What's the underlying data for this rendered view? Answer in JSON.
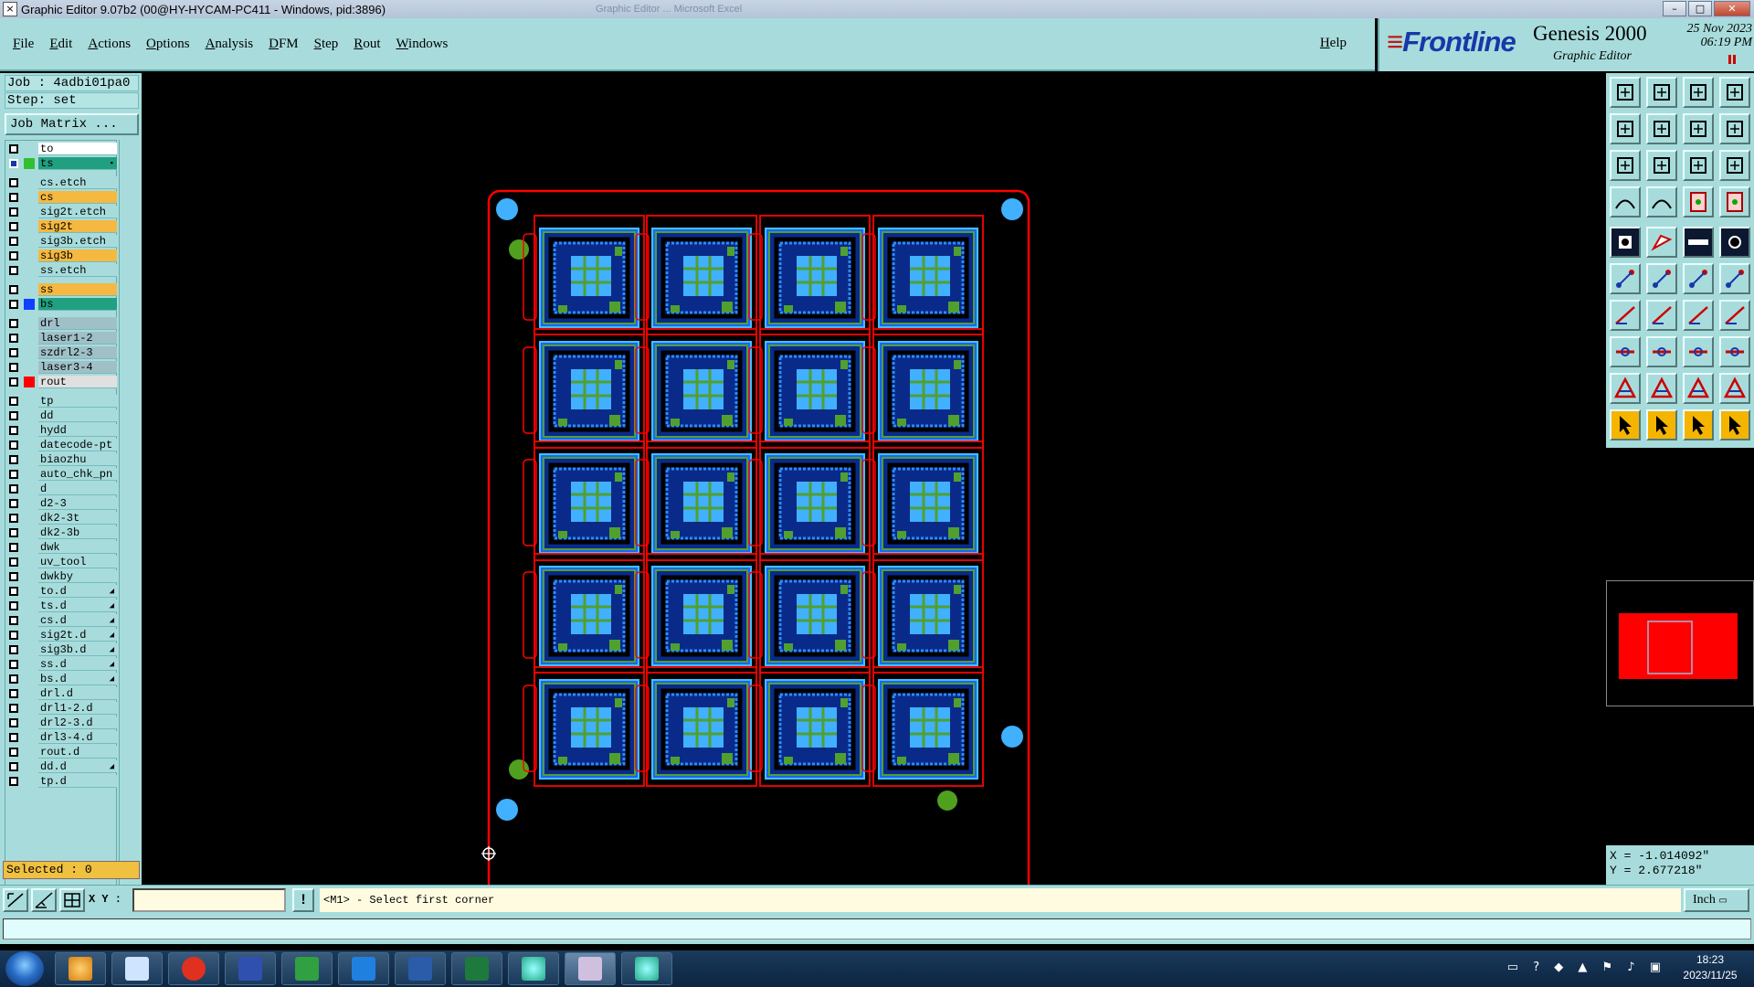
{
  "window": {
    "title": "Graphic Editor 9.07b2 (00@HY-HYCAM-PC411 - Windows, pid:3896)",
    "ghost_text": "Graphic Editor ... Microsoft Excel"
  },
  "menu": {
    "items": [
      "File",
      "Edit",
      "Actions",
      "Options",
      "Analysis",
      "DFM",
      "Step",
      "Rout",
      "Windows"
    ],
    "help": "Help"
  },
  "brand": {
    "logo": "Frontline",
    "product": "Genesis 2000",
    "subtitle": "Graphic Editor",
    "date_line1": "25 Nov 2023",
    "date_line2": "06:19 PM"
  },
  "job": {
    "job_label": "Job : 4adbi01pa0",
    "step_label": "Step: set",
    "matrix_button": "Job Matrix ..."
  },
  "layers": [
    {
      "name": "to",
      "bg": "#ffffff",
      "swatch": "",
      "group": 0,
      "selected": false
    },
    {
      "name": "ts",
      "bg": "#20a080",
      "swatch": "#30c030",
      "group": 0,
      "selected": true
    },
    {
      "name": "cs.etch",
      "bg": "#a8dcdc",
      "swatch": "",
      "group": 1
    },
    {
      "name": "cs",
      "bg": "#f5b840",
      "swatch": "",
      "group": 1
    },
    {
      "name": "sig2t.etch",
      "bg": "#a8dcdc",
      "swatch": "",
      "group": 1
    },
    {
      "name": "sig2t",
      "bg": "#f5b840",
      "swatch": "",
      "group": 1
    },
    {
      "name": "sig3b.etch",
      "bg": "#a8dcdc",
      "swatch": "",
      "group": 1
    },
    {
      "name": "sig3b",
      "bg": "#f5b840",
      "swatch": "",
      "group": 1
    },
    {
      "name": "ss.etch",
      "bg": "#a8dcdc",
      "swatch": "",
      "group": 1
    },
    {
      "name": "ss",
      "bg": "#f5b840",
      "swatch": "",
      "group": 2
    },
    {
      "name": "bs",
      "bg": "#20a080",
      "swatch": "#1040ff",
      "group": 2
    },
    {
      "name": "drl",
      "bg": "#a0c0c8",
      "swatch": "",
      "group": 3
    },
    {
      "name": "laser1-2",
      "bg": "#a0c0c8",
      "swatch": "",
      "group": 3
    },
    {
      "name": "szdrl2-3",
      "bg": "#a0c0c8",
      "swatch": "",
      "group": 3
    },
    {
      "name": "laser3-4",
      "bg": "#a0c0c8",
      "swatch": "",
      "group": 3
    },
    {
      "name": "rout",
      "bg": "#e0e0e0",
      "swatch": "#ff0000",
      "group": 3
    },
    {
      "name": "tp",
      "bg": "#a8dcdc",
      "swatch": "",
      "group": 4
    },
    {
      "name": "dd",
      "bg": "#a8dcdc",
      "swatch": "",
      "group": 4
    },
    {
      "name": "hydd",
      "bg": "#a8dcdc",
      "swatch": "",
      "group": 4
    },
    {
      "name": "datecode-pt",
      "bg": "#a8dcdc",
      "swatch": "",
      "group": 4
    },
    {
      "name": "biaozhu",
      "bg": "#a8dcdc",
      "swatch": "",
      "group": 4
    },
    {
      "name": "auto_chk_pn",
      "bg": "#a8dcdc",
      "swatch": "",
      "group": 4
    },
    {
      "name": "d",
      "bg": "#a8dcdc",
      "swatch": "",
      "group": 4
    },
    {
      "name": "d2-3",
      "bg": "#a8dcdc",
      "swatch": "",
      "group": 4
    },
    {
      "name": "dk2-3t",
      "bg": "#a8dcdc",
      "swatch": "",
      "group": 4
    },
    {
      "name": "dk2-3b",
      "bg": "#a8dcdc",
      "swatch": "",
      "group": 4
    },
    {
      "name": "dwk",
      "bg": "#a8dcdc",
      "swatch": "",
      "group": 4
    },
    {
      "name": "uv_tool",
      "bg": "#a8dcdc",
      "swatch": "",
      "group": 4
    },
    {
      "name": "dwkby",
      "bg": "#a8dcdc",
      "swatch": "",
      "group": 4
    },
    {
      "name": "to.d",
      "bg": "#a8dcdc",
      "swatch": "",
      "group": 4,
      "arrow": true
    },
    {
      "name": "ts.d",
      "bg": "#a8dcdc",
      "swatch": "",
      "group": 4,
      "arrow": true
    },
    {
      "name": "cs.d",
      "bg": "#a8dcdc",
      "swatch": "",
      "group": 4,
      "arrow": true
    },
    {
      "name": "sig2t.d",
      "bg": "#a8dcdc",
      "swatch": "",
      "group": 4,
      "arrow": true
    },
    {
      "name": "sig3b.d",
      "bg": "#a8dcdc",
      "swatch": "",
      "group": 4,
      "arrow": true
    },
    {
      "name": "ss.d",
      "bg": "#a8dcdc",
      "swatch": "",
      "group": 4,
      "arrow": true
    },
    {
      "name": "bs.d",
      "bg": "#a8dcdc",
      "swatch": "",
      "group": 4,
      "arrow": true
    },
    {
      "name": "drl.d",
      "bg": "#a8dcdc",
      "swatch": "",
      "group": 4
    },
    {
      "name": "drl1-2.d",
      "bg": "#a8dcdc",
      "swatch": "",
      "group": 4
    },
    {
      "name": "drl2-3.d",
      "bg": "#a8dcdc",
      "swatch": "",
      "group": 4
    },
    {
      "name": "drl3-4.d",
      "bg": "#a8dcdc",
      "swatch": "",
      "group": 4
    },
    {
      "name": "rout.d",
      "bg": "#a8dcdc",
      "swatch": "",
      "group": 4
    },
    {
      "name": "dd.d",
      "bg": "#a8dcdc",
      "swatch": "",
      "group": 4,
      "arrow": true
    },
    {
      "name": "tp.d",
      "bg": "#a8dcdc",
      "swatch": "",
      "group": 4
    }
  ],
  "selection": {
    "label": "Selected : 0"
  },
  "toolbox": [
    "open-step-icon",
    "save-icon",
    "home-icon",
    "window-icon",
    "pan-left-icon",
    "pan-right-icon",
    "zoom-back-icon",
    "redraw-icon",
    "zoom-fit-icon",
    "zoom-center-icon",
    "ratio-icon",
    "help-icon",
    "snap-icon",
    "grid-icon",
    "layer-up-icon",
    "layer-down-icon",
    "feature-select-icon",
    "polygon-icon",
    "measure-icon",
    "pad-icon",
    "connect-icon",
    "cross-icon",
    "line-icon",
    "arc-icon",
    "slope-icon",
    "diagonal-icon",
    "rotate-icon",
    "mirror-icon",
    "move-icon",
    "dash-icon",
    "align-icon",
    "copy-icon",
    "outline-icon",
    "text-a-icon",
    "text-b-icon",
    "text-c-icon",
    "pointer-icon",
    "pointer-box-icon",
    "pointer-lasso-icon",
    "route-icon"
  ],
  "coords": {
    "x": "X = -1.014092\"",
    "y": "Y = 2.677218\""
  },
  "status": {
    "xy_label": "X Y :",
    "xy_value": "",
    "prompt": "<M1> - Select first corner",
    "units": "Inch"
  },
  "taskbar": {
    "time": "18:23",
    "date": "2023/11/25"
  },
  "colors": {
    "panel": "#a8dcdc",
    "board_outline": "#ff0000",
    "fiducial_blue": "#40b0ff",
    "fiducial_green": "#50a020"
  }
}
